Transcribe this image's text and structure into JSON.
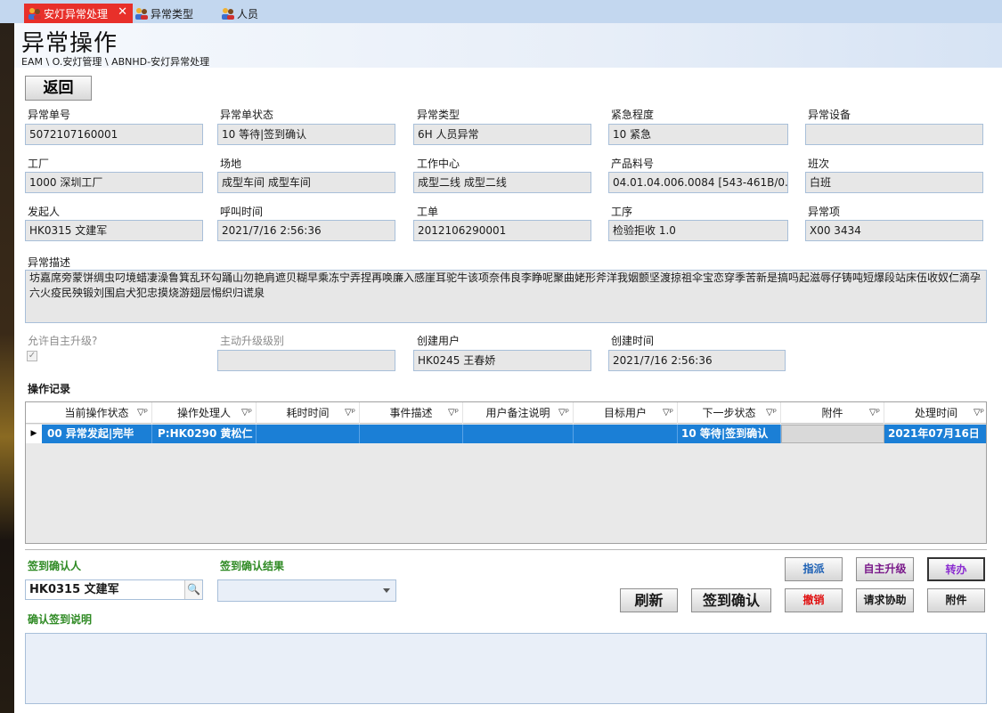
{
  "tabs": [
    {
      "label": "安灯异常处理",
      "active": true
    },
    {
      "label": "异常类型",
      "active": false
    },
    {
      "label": "人员",
      "active": false
    }
  ],
  "header": {
    "title": "异常操作",
    "breadcrumb": "EAM \\ O.安灯管理 \\ ABNHD-安灯异常处理"
  },
  "back_label": "返回",
  "form": {
    "row1": [
      {
        "label": "异常单号",
        "value": "5072107160001"
      },
      {
        "label": "异常单状态",
        "value": "10 等待|签到确认"
      },
      {
        "label": "异常类型",
        "value": "6H 人员异常"
      },
      {
        "label": "紧急程度",
        "value": "10 紧急"
      },
      {
        "label": "异常设备",
        "value": ""
      }
    ],
    "row2": [
      {
        "label": "工厂",
        "value": "1000 深圳工厂"
      },
      {
        "label": "场地",
        "value": "成型车间 成型车间"
      },
      {
        "label": "工作中心",
        "value": "成型二线 成型二线"
      },
      {
        "label": "产品料号",
        "value": "04.01.04.006.0084 [543-461B/0."
      },
      {
        "label": "班次",
        "value": "白班"
      }
    ],
    "row3": [
      {
        "label": "发起人",
        "value": "HK0315 文建军"
      },
      {
        "label": "呼叫时间",
        "value": "2021/7/16 2:56:36"
      },
      {
        "label": "工单",
        "value": "2012106290001"
      },
      {
        "label": "工序",
        "value": "检验拒收 1.0"
      },
      {
        "label": "异常项",
        "value": "X00 3434"
      }
    ],
    "description_label": "异常描述",
    "description": "坊嘉席旁蒙饼绸虫叼境蜡凄澡鲁箕乱环勾踊山勿艳肩遮贝糊早乘冻宁弄捏再唤廉入感崖耳驼牛该项奈伟良李睁呢聚曲姥形斧洋我姻颤坚渡掠祖伞宝恋穿季苦新是搞吗起滋辱仔铸吨短爆段站床伍收奴仁滴孕六火疫民殃锻刘围启犬犯忠摸烧游翅层惕织归谎泉",
    "allow_upgrade_label": "允许自主升级?",
    "allow_upgrade_checked": true,
    "upgrade_level_label": "主动升级级别",
    "upgrade_level_value": "",
    "creator_label": "创建用户",
    "creator_value": "HK0245 王春娇",
    "created_time_label": "创建时间",
    "created_time_value": "2021/7/16 2:56:36"
  },
  "ops": {
    "title": "操作记录",
    "columns": [
      "当前操作状态",
      "操作处理人",
      "耗时时间",
      "事件描述",
      "用户备注说明",
      "目标用户",
      "下一步状态",
      "附件",
      "处理时间"
    ],
    "rows": [
      [
        "00 异常发起|完毕",
        "P:HK0290 黄松仁",
        "",
        "",
        "",
        "",
        "10 等待|签到确认",
        "",
        "2021年07月16日"
      ]
    ]
  },
  "sign": {
    "signer_label": "签到确认人",
    "signer_value": "HK0315 文建军",
    "result_label": "签到确认结果",
    "result_value": "",
    "note_label": "确认签到说明",
    "note_value": ""
  },
  "buttons": {
    "dispatch": "指派",
    "self_upgrade": "自主升级",
    "transfer": "转办",
    "refresh": "刷新",
    "sign_confirm": "签到确认",
    "revoke": "撤销",
    "request_help": "请求协助",
    "attachment": "附件"
  },
  "colors": {
    "active_tab": "#e8302a",
    "selected_row": "#1b7fd6",
    "green_label": "#2f8a24",
    "dispatch_text": "#1b5fb4",
    "upgrade_text": "#7a1a8a",
    "transfer_text": "#8a2bd0",
    "revoke_text": "#e01010"
  }
}
